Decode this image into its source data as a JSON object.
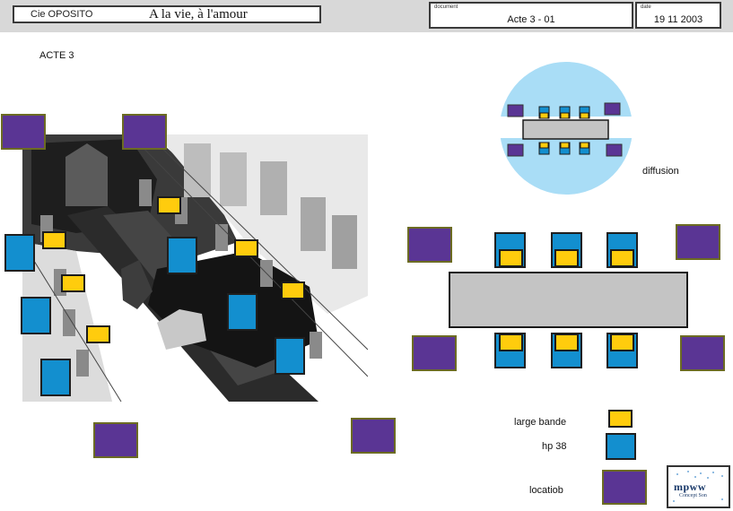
{
  "header": {
    "company": "Cie OPOSITO",
    "show": "A la vie, à l'amour",
    "document_label": "document",
    "document_value": "Acte 3 - 01",
    "date_label": "date",
    "date_value": "19 11 2003"
  },
  "act_label": "ACTE 3",
  "diffusion_label": "diffusion",
  "legend": {
    "large_bande": "large bande",
    "hp38": "hp 38",
    "location": "locatiob"
  },
  "logo": {
    "wordmark": "mpww",
    "subtitle": "Concept Son"
  },
  "colors": {
    "location": "#5a3594",
    "large_bande": "#ffcc0d",
    "hp38": "#138fcf",
    "stage": "#c4c4c4",
    "diffusion_circle": "#a9ddf6"
  }
}
